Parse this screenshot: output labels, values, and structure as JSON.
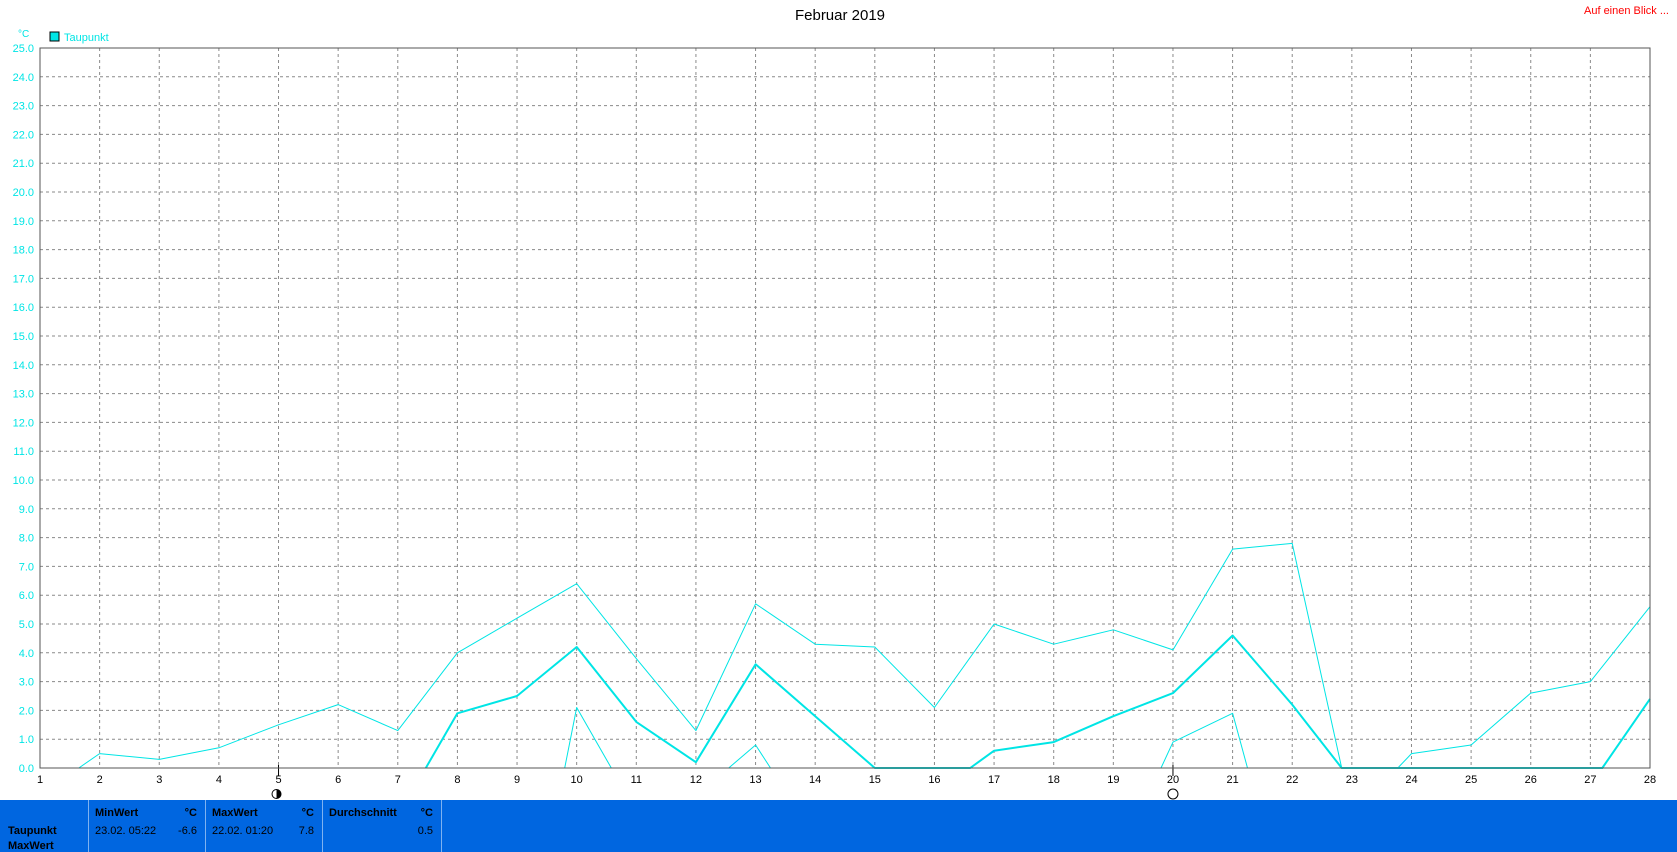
{
  "header": {
    "title": "Februar 2019",
    "link_label": "Auf einen Blick ..."
  },
  "chart_data": {
    "type": "line",
    "title": "Februar 2019",
    "unit": "°C",
    "legend": [
      "Taupunkt"
    ],
    "legend_color": "#00e5e5",
    "ylim": [
      0,
      25
    ],
    "xlim": [
      1,
      28
    ],
    "y_ticks": [
      "0.0",
      "1.0",
      "2.0",
      "3.0",
      "4.0",
      "5.0",
      "6.0",
      "7.0",
      "8.0",
      "9.0",
      "10.0",
      "11.0",
      "12.0",
      "13.0",
      "14.0",
      "15.0",
      "16.0",
      "17.0",
      "18.0",
      "19.0",
      "20.0",
      "21.0",
      "22.0",
      "23.0",
      "24.0",
      "25.0"
    ],
    "x_ticks": [
      "1",
      "2",
      "3",
      "4",
      "5",
      "6",
      "7",
      "8",
      "9",
      "10",
      "11",
      "12",
      "13",
      "14",
      "15",
      "16",
      "17",
      "18",
      "19",
      "20",
      "21",
      "22",
      "23",
      "24",
      "25",
      "26",
      "27",
      "28"
    ],
    "grid": true,
    "series": [
      {
        "name": "Taupunkt",
        "role": "max",
        "stroke": 1,
        "x": [
          1.65,
          2,
          3,
          4,
          5,
          6,
          7,
          8,
          9,
          10,
          11,
          12,
          13,
          14,
          15,
          16,
          17,
          18,
          19,
          20,
          21,
          22,
          22.83,
          23.77,
          24,
          25,
          26,
          27,
          28
        ],
        "y": [
          0,
          0.5,
          0.3,
          0.7,
          1.5,
          2.2,
          1.3,
          4.0,
          5.2,
          6.4,
          3.8,
          1.3,
          5.7,
          4.3,
          4.2,
          2.1,
          5.0,
          4.3,
          4.8,
          4.1,
          7.6,
          7.8,
          0,
          0,
          0.5,
          0.8,
          2.6,
          3.0,
          5.6
        ]
      },
      {
        "name": "Taupunkt",
        "role": "mean",
        "stroke": 2,
        "x": [
          7.47,
          8,
          9,
          10,
          11,
          12,
          13,
          14,
          15,
          16.6,
          17,
          18,
          19,
          20,
          21,
          22,
          22.83,
          27.2,
          28
        ],
        "y": [
          0,
          1.9,
          2.5,
          4.2,
          1.6,
          0.2,
          3.6,
          1.8,
          0,
          0,
          0.6,
          0.9,
          1.8,
          2.6,
          4.6,
          2.2,
          0,
          0,
          2.4
        ]
      },
      {
        "name": "Taupunkt",
        "role": "min",
        "stroke": 1,
        "x": [
          9.8,
          10,
          10.58
        ],
        "y": [
          0,
          2.1,
          0
        ]
      },
      {
        "name": "Taupunkt",
        "role": "min",
        "stroke": 1,
        "x": [
          12.55,
          13,
          13.25
        ],
        "y": [
          0,
          0.8,
          0
        ]
      },
      {
        "name": "Taupunkt",
        "role": "min",
        "stroke": 1,
        "x": [
          19.8,
          20,
          21,
          21.25
        ],
        "y": [
          0,
          0.9,
          1.9,
          0
        ]
      }
    ],
    "moon_phases": [
      {
        "day": 5,
        "phase": "new"
      },
      {
        "day": 20,
        "phase": "full"
      }
    ]
  },
  "stats": {
    "row_labels": [
      "Taupunkt",
      "MaxWert"
    ],
    "min": {
      "header": "MinWert",
      "unit": "°C",
      "time": "23.02.  05:22",
      "value": "-6.6"
    },
    "max": {
      "header": "MaxWert",
      "unit": "°C",
      "time": "22.02.  01:20",
      "value": "7.8"
    },
    "avg": {
      "header": "Durchschnitt",
      "unit": "°C",
      "value": "0.5"
    }
  }
}
